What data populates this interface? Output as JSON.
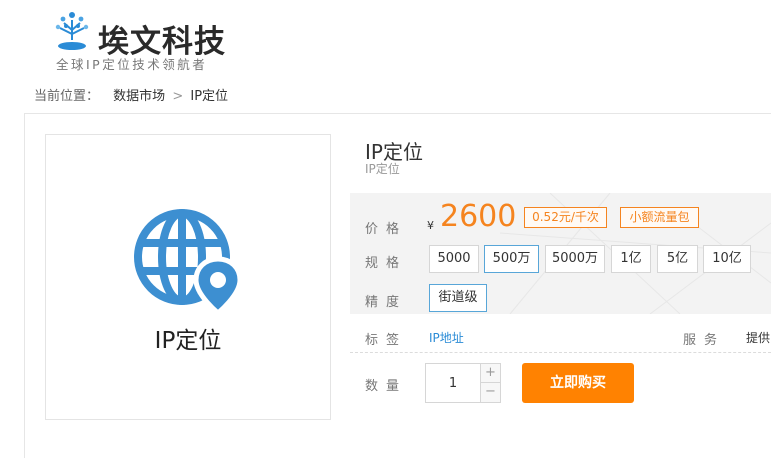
{
  "brand": {
    "name": "埃文科技",
    "tagline": "全球IP定位技术领航者",
    "logo_icon": "tree-person-icon",
    "logo_color": "#2a8bd6"
  },
  "breadcrumb": {
    "label": "当前位置：",
    "items": [
      "数据市场",
      "IP定位"
    ],
    "separator": ">"
  },
  "product": {
    "image_caption": "IP定位",
    "image_icon": "globe-location-icon",
    "title": "IP定位",
    "subtitle": "IP定位"
  },
  "price": {
    "label": "价格",
    "currency": "¥",
    "value": "2600",
    "unit_tag": "0.52元/千次",
    "promo_tag": "小额流量包"
  },
  "spec": {
    "label": "规格",
    "options": [
      "5000",
      "500万",
      "5000万",
      "1亿",
      "5亿",
      "10亿"
    ],
    "selected": "500万"
  },
  "precision": {
    "label": "精度",
    "options": [
      "街道级"
    ]
  },
  "tags": {
    "label": "标签",
    "value": "IP地址",
    "service_label": "服务",
    "service_value": "提供"
  },
  "quantity": {
    "label": "数量",
    "value": "1",
    "plus": "+",
    "minus": "−"
  },
  "buy_button": "立即购买",
  "colors": {
    "accent_orange": "#f5841f",
    "button_orange": "#ff8201",
    "link_blue": "#2a8bd6",
    "globe_blue": "#3d8fd1"
  }
}
